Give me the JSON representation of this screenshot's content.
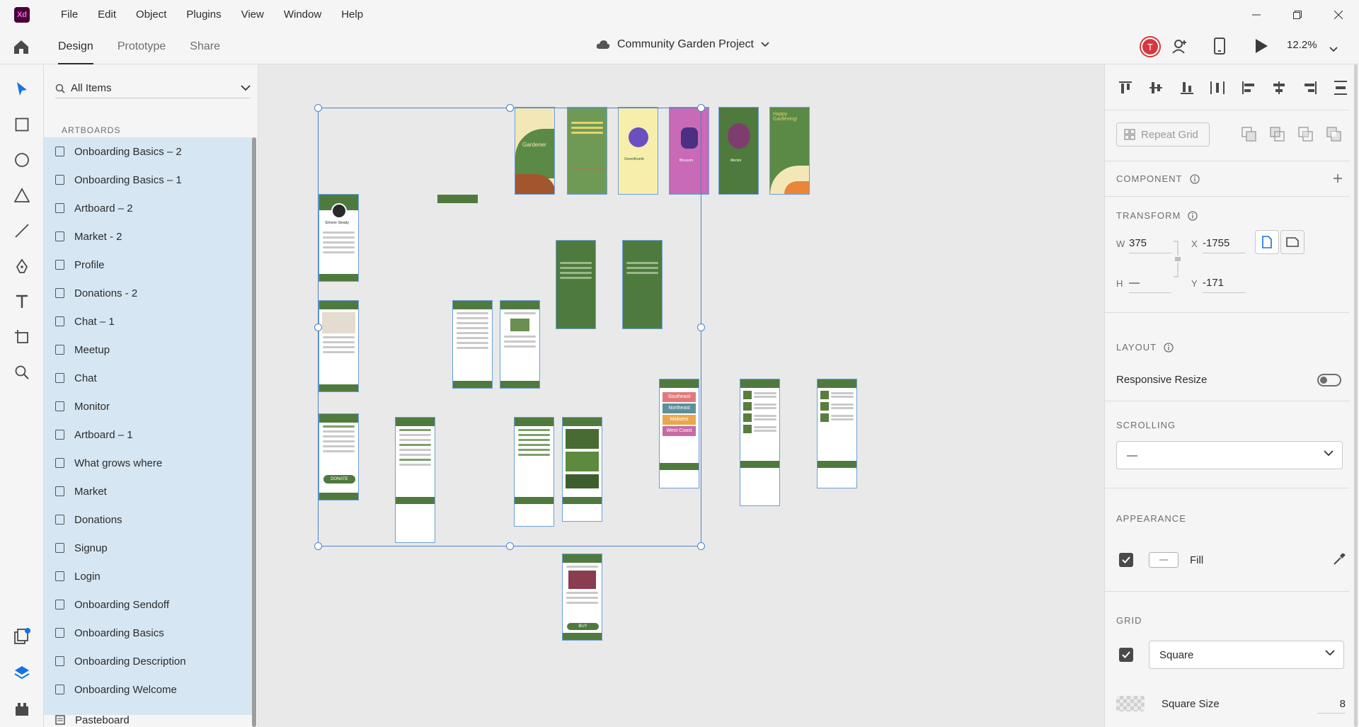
{
  "app": {
    "logo_text": "Xd"
  },
  "menu": [
    "File",
    "Edit",
    "Object",
    "Plugins",
    "View",
    "Window",
    "Help"
  ],
  "tabs": [
    {
      "label": "Design",
      "active": true
    },
    {
      "label": "Prototype",
      "active": false
    },
    {
      "label": "Share",
      "active": false
    }
  ],
  "document": {
    "title": "Community Garden Project"
  },
  "user": {
    "initial": "T"
  },
  "zoom": "12.2%",
  "layers": {
    "search_value": "All Items",
    "heading": "ARTBOARDS",
    "items": [
      "Onboarding Basics – 2",
      "Onboarding Basics – 1",
      "Artboard – 2",
      "Market - 2",
      "Profile",
      "Donations - 2",
      "Chat – 1",
      "Meetup",
      "Chat",
      "Monitor",
      "Artboard – 1",
      "What grows where",
      "Market",
      "Donations",
      "Signup",
      "Login",
      "Onboarding Sendoff",
      "Onboarding Basics",
      "Onboarding Description",
      "Onboarding Welcome"
    ],
    "pasteboard": "Pasteboard"
  },
  "canvas": {
    "onboarding": [
      "Gardener",
      "WELCOME TO COMGAR",
      "Greenthumb",
      "Blossom",
      "Mentor",
      "Happy Gardening!"
    ],
    "regions": [
      "Southeast",
      "Northeast",
      "Midwest",
      "West Coast"
    ],
    "donate_label": "DONATE",
    "buy_label": "BUY",
    "profile_name": "Simone Steady"
  },
  "inspector": {
    "repeat_grid": "Repeat Grid",
    "component_title": "COMPONENT",
    "transform_title": "TRANSFORM",
    "w_label": "W",
    "w_value": "375",
    "h_label": "H",
    "h_value": "—",
    "x_label": "X",
    "x_value": "-1755",
    "y_label": "Y",
    "y_value": "-171",
    "layout_title": "LAYOUT",
    "responsive_resize": "Responsive Resize",
    "scrolling_title": "SCROLLING",
    "scrolling_value": "—",
    "appearance_title": "APPEARANCE",
    "fill_label": "Fill",
    "grid_title": "GRID",
    "grid_value": "Square",
    "square_size_label": "Square Size",
    "square_size_value": "8"
  },
  "colors": {
    "brand_green": "#4f7a3d",
    "selection_blue": "#4a84c8",
    "layer_highlight": "#d6e7f3",
    "avatar_red": "#d7373f"
  }
}
